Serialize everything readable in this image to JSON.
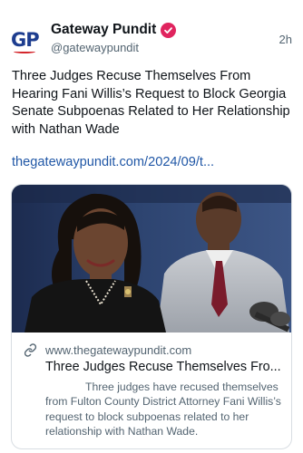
{
  "account": {
    "avatar_text_g": "G",
    "avatar_text_p": "P",
    "display_name": "Gateway Pundit",
    "handle": "@gatewaypundit",
    "time": "2h",
    "verified_icon": "verified-badge-icon",
    "verified_color": "#e0245e"
  },
  "post": {
    "text": "Three Judges Recuse Themselves From Hearing Fani Willis’s Request to Block Georgia Senate Subpoenas Related to Her Relationship with Nathan Wade",
    "link": "thegatewaypundit.com/2024/09/t...",
    "link_color": "#2057a6"
  },
  "card": {
    "domain_icon": "link-icon",
    "domain": "www.thegatewaypundit.com",
    "title": "Three Judges Recuse Themselves Fro...",
    "description": "Three judges have recused themselves from Fulton County District Attorney Fani Willis’s request to block subpoenas related to her relationship with Nathan Wade."
  }
}
